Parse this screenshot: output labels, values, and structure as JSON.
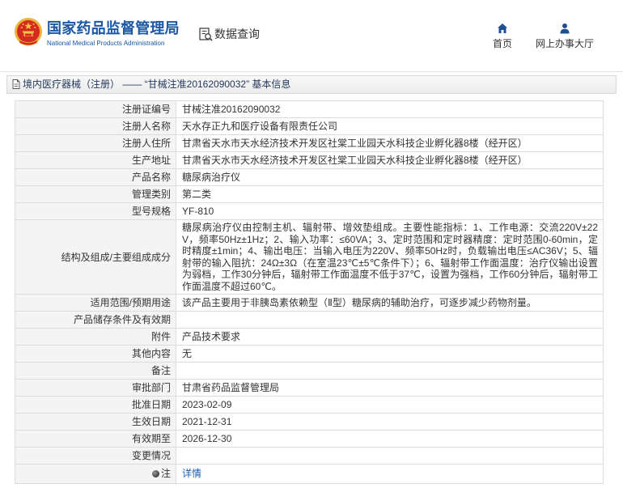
{
  "header": {
    "logo_icon": "national-emblem-icon",
    "org_name_cn": "国家药品监督管理局",
    "org_name_en": "National Medical Products Administration",
    "section_icon": "data-query-icon",
    "section_title": "数据查询",
    "nav": [
      {
        "icon": "home-icon",
        "label": "首页"
      },
      {
        "icon": "user-icon",
        "label": "网上办事大厅"
      }
    ]
  },
  "breadcrumb": {
    "icon": "document-icon",
    "text": "境内医疗器械（注册） —— “甘械注准20162090032” 基本信息"
  },
  "record": {
    "rows": [
      {
        "label": "注册证编号",
        "value": "甘械注准20162090032"
      },
      {
        "label": "注册人名称",
        "value": "天水存正九和医疗设备有限责任公司"
      },
      {
        "label": "注册人住所",
        "value": "甘肃省天水市天水经济技术开发区社棠工业园天水科技企业孵化器8楼（经开区）"
      },
      {
        "label": "生产地址",
        "value": "甘肃省天水市天水经济技术开发区社棠工业园天水科技企业孵化器8楼（经开区）"
      },
      {
        "label": "产品名称",
        "value": "糖尿病治疗仪"
      },
      {
        "label": "管理类别",
        "value": "第二类"
      },
      {
        "label": "型号规格",
        "value": "YF-810"
      },
      {
        "label": "结构及组成/主要组成成分",
        "value": "糖尿病治疗仪由控制主机、辐射带、增效垫组成。主要性能指标：1、工作电源：交流220V±22V，频率50Hz±1Hz；2、输入功率：≤60VA；3、定时范围和定时器精度：定时范围0-60min，定时精度±1min；4、输出电压：当输入电压为220V、频率50Hz时，负载输出电压≤AC36V；5、辐射带的输入阻抗：24Ω±3Ω（在室温23℃±5℃条件下）；6、辐射带工作面温度：治疗仪输出设置为弱档，工作30分钟后，辐射带工作面温度不低于37℃，设置为强档，工作60分钟后，辐射带工作面温度不超过60℃。"
      },
      {
        "label": "适用范围/预期用途",
        "value": "该产品主要用于非胰岛素依赖型（Ⅱ型）糖尿病的辅助治疗，可逐步减少药物剂量。"
      },
      {
        "label": "产品储存条件及有效期",
        "value": ""
      },
      {
        "label": "附件",
        "value": "产品技术要求"
      },
      {
        "label": "其他内容",
        "value": "无"
      },
      {
        "label": "备注",
        "value": ""
      },
      {
        "label": "审批部门",
        "value": "甘肃省药品监督管理局"
      },
      {
        "label": "批准日期",
        "value": "2023-02-09"
      },
      {
        "label": "生效日期",
        "value": "2021-12-31"
      },
      {
        "label": "有效期至",
        "value": "2026-12-30"
      },
      {
        "label": "变更情况",
        "value": ""
      }
    ],
    "note": {
      "icon": "note-icon",
      "label": "注",
      "link_text": "详情"
    }
  },
  "colors": {
    "brand": "#1b57a4",
    "link": "#1a5eb5",
    "label-bg": "#f4f4f4",
    "border": "#dcdcdc"
  }
}
